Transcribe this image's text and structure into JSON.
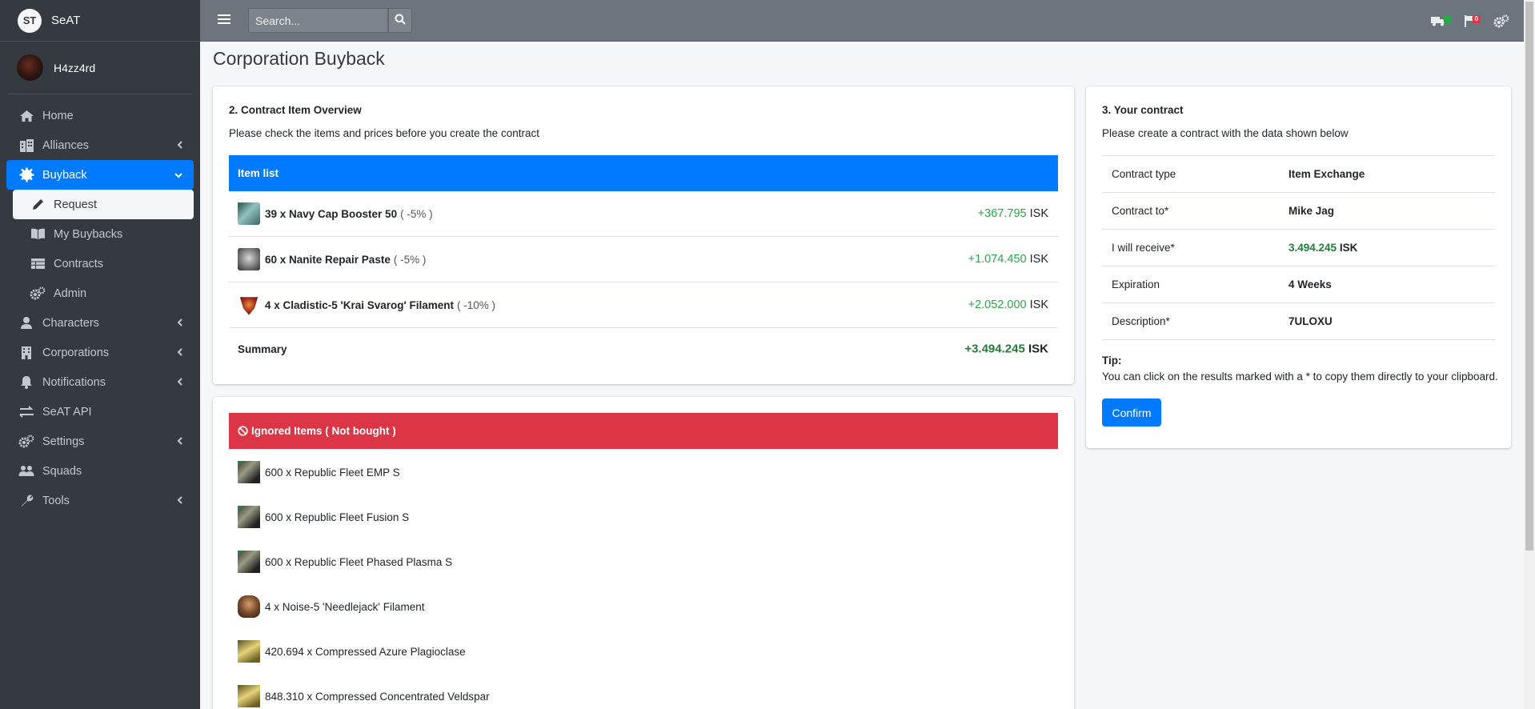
{
  "brand": {
    "logo": "ST",
    "name": "SeAT"
  },
  "user": {
    "name": "H4zz4rd"
  },
  "sidebar": {
    "items": [
      {
        "label": "Home",
        "icon": "home-icon"
      },
      {
        "label": "Alliances",
        "icon": "building-icon"
      },
      {
        "label": "Buyback",
        "icon": "gear-badge-icon"
      },
      {
        "label": "Characters",
        "icon": "user-icon"
      },
      {
        "label": "Corporations",
        "icon": "corporation-icon"
      },
      {
        "label": "Notifications",
        "icon": "bell-icon"
      },
      {
        "label": "SeAT API",
        "icon": "exchange-icon"
      },
      {
        "label": "Settings",
        "icon": "cogs-icon"
      },
      {
        "label": "Squads",
        "icon": "users-icon"
      },
      {
        "label": "Tools",
        "icon": "wrench-icon"
      }
    ],
    "buyback_sub": [
      {
        "label": "Request",
        "icon": "pencil-icon"
      },
      {
        "label": "My Buybacks",
        "icon": "book-icon"
      },
      {
        "label": "Contracts",
        "icon": "table-icon"
      },
      {
        "label": "Admin",
        "icon": "cogs-icon"
      }
    ]
  },
  "topbar": {
    "search_placeholder": "Search...",
    "badges": {
      "queue": "0",
      "errors": "0"
    }
  },
  "page": {
    "title": "Corporation Buyback"
  },
  "overview": {
    "title": "2. Contract Item Overview",
    "subtitle": "Please check the items and prices before you create the contract",
    "list_header": "Item list",
    "items": [
      {
        "name": "39 x Navy Cap Booster 50",
        "pct": "( -5% )",
        "price": "+367.795",
        "unit": " ISK"
      },
      {
        "name": "60 x Nanite Repair Paste",
        "pct": "( -5% )",
        "price": "+1.074.450",
        "unit": " ISK"
      },
      {
        "name": "4 x Cladistic-5 'Krai Svarog' Filament",
        "pct": "( -10% )",
        "price": "+2.052.000",
        "unit": " ISK"
      }
    ],
    "summary_label": "Summary",
    "summary_price": "+3.494.245",
    "summary_unit": " ISK"
  },
  "ignored": {
    "header": "Ignored Items ( Not bought )",
    "items": [
      "600 x Republic Fleet EMP S",
      "600 x Republic Fleet Fusion S",
      "600 x Republic Fleet Phased Plasma S",
      "4 x Noise-5 'Needlejack' Filament",
      "420.694 x Compressed Azure Plagioclase",
      "848.310 x Compressed Concentrated Veldspar"
    ]
  },
  "contract": {
    "title": "3. Your contract",
    "subtitle": "Please create a contract with the data shown below",
    "rows": [
      {
        "key": "Contract type",
        "value": "Item Exchange"
      },
      {
        "key": "Contract to*",
        "value": "Mike Jag"
      },
      {
        "key": "I will receive*",
        "value": "3.494.245",
        "unit": " ISK"
      },
      {
        "key": "Expiration",
        "value": "4 Weeks"
      },
      {
        "key": "Description*",
        "value": "7ULOXU"
      }
    ],
    "tip_heading": "Tip:",
    "tip_text": "You can click on the results marked with a * to copy them directly to your clipboard.",
    "confirm_label": "Confirm"
  },
  "colors": {
    "primary": "#007bff",
    "danger": "#dc3545",
    "success": "#28a745",
    "sidebar": "#343a40",
    "navbar": "#6c757d"
  }
}
